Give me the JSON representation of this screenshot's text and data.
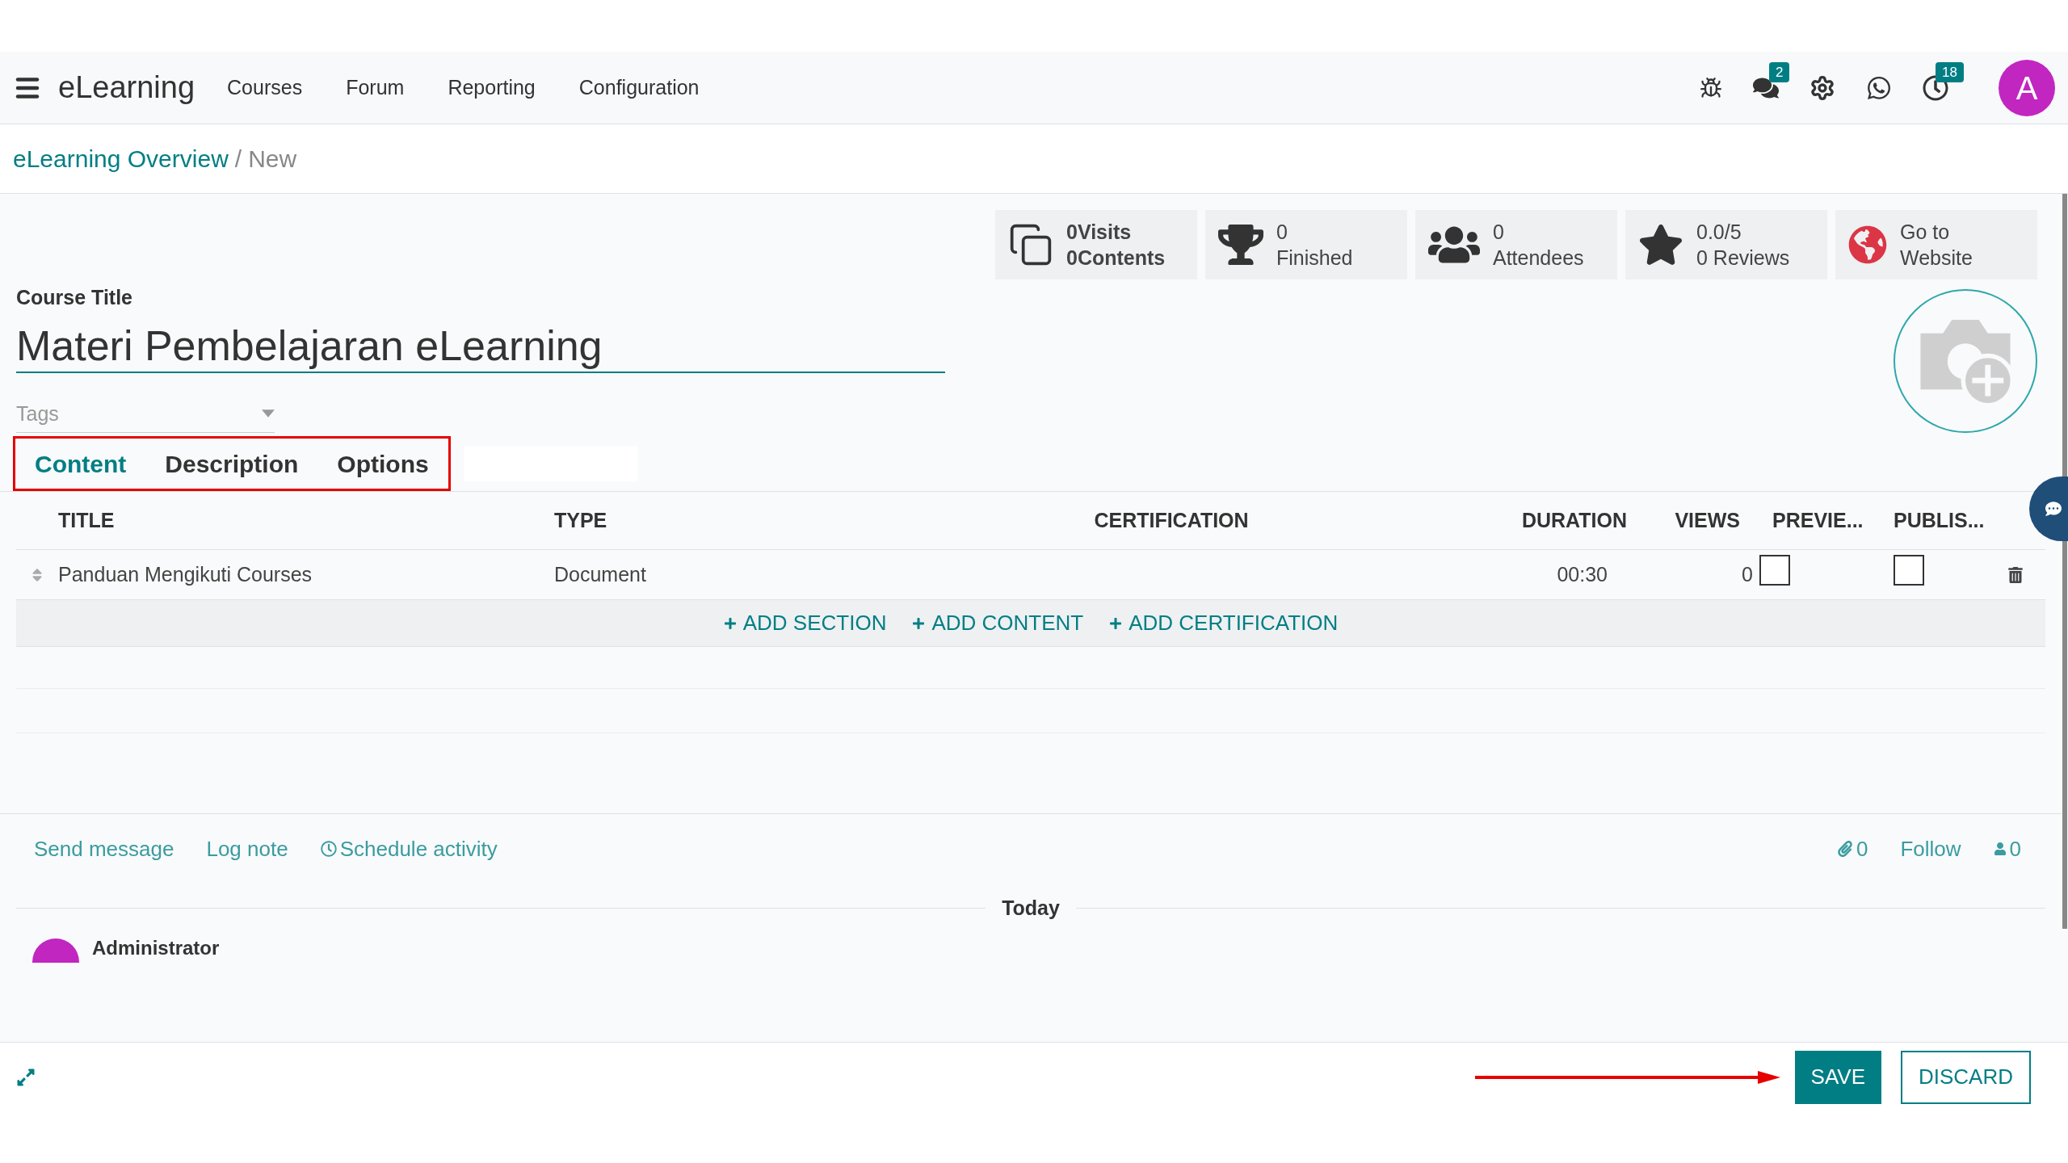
{
  "navbar": {
    "app_name": "eLearning",
    "menu": [
      "Courses",
      "Forum",
      "Reporting",
      "Configuration"
    ],
    "messages_badge": "2",
    "activity_badge": "18",
    "avatar_letter": "A"
  },
  "breadcrumb": {
    "parent": "eLearning Overview",
    "separator": "/",
    "current": "New"
  },
  "stats": [
    {
      "kind": "visits",
      "line1": "0Visits",
      "line2": "0Contents"
    },
    {
      "kind": "finished",
      "line1": "0",
      "line2": "Finished"
    },
    {
      "kind": "attendees",
      "line1": "0",
      "line2": "Attendees"
    },
    {
      "kind": "rating",
      "line1": "0.0/5",
      "line2": "0 Reviews"
    },
    {
      "kind": "website",
      "line1": "Go to",
      "line2": "Website"
    }
  ],
  "form": {
    "title_label": "Course Title",
    "title_value": "Materi Pembelajaran eLearning",
    "tags_placeholder": "Tags"
  },
  "tabs": [
    {
      "label": "Content",
      "selected": true
    },
    {
      "label": "Description",
      "selected": false
    },
    {
      "label": "Options",
      "selected": false
    }
  ],
  "table": {
    "columns": [
      "TITLE",
      "TYPE",
      "CERTIFICATION",
      "DURATION",
      "VIEWS",
      "PREVIE...",
      "PUBLIS..."
    ],
    "rows": [
      {
        "title": "Panduan Mengikuti Courses",
        "type": "Document",
        "duration": "00:30",
        "views": "0",
        "preview": false,
        "published": false
      }
    ],
    "add_links": [
      "ADD SECTION",
      "ADD CONTENT",
      "ADD CERTIFICATION"
    ]
  },
  "chatter": {
    "actions": [
      "Send message",
      "Log note",
      "Schedule activity"
    ],
    "attachments": "0",
    "follow": "Follow",
    "followers": "0",
    "date_separator": "Today",
    "author": "Administrator"
  },
  "footer": {
    "buttons": [
      {
        "label": "SAVE",
        "kind": "primary"
      },
      {
        "label": "DISCARD",
        "kind": "secondary"
      }
    ]
  }
}
